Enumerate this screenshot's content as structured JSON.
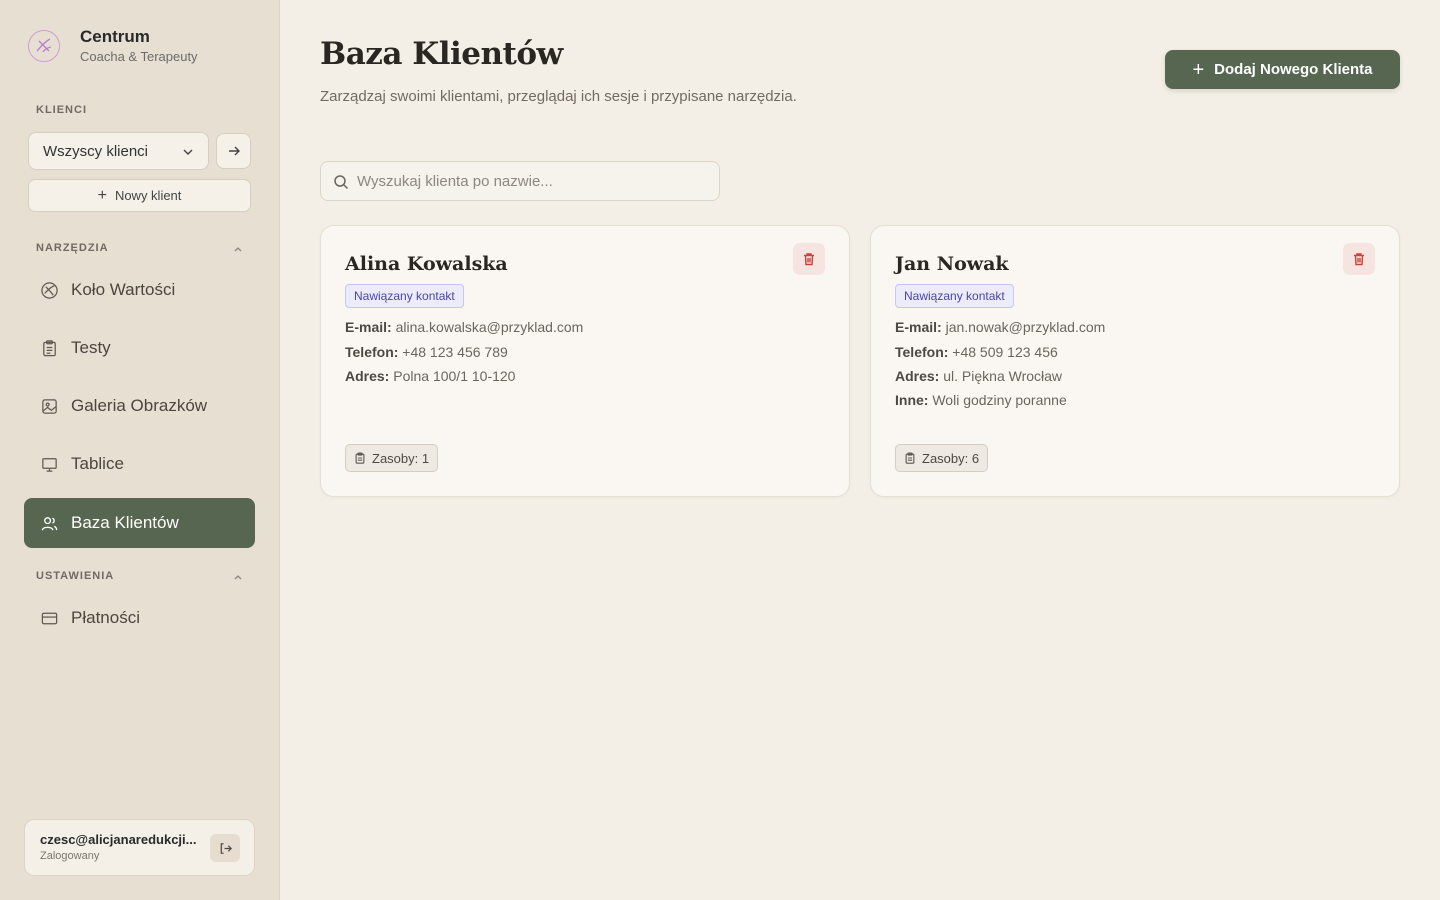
{
  "brand": {
    "title": "Centrum",
    "subtitle": "Coacha & Terapeuty"
  },
  "sidebar": {
    "clients_label": "KLIENCI",
    "client_select_value": "Wszyscy klienci",
    "new_client_label": "Nowy klient",
    "tools_label": "NARZĘDZIA",
    "tools": [
      {
        "label": "Koło Wartości",
        "icon": "wheel-icon"
      },
      {
        "label": "Testy",
        "icon": "clipboard-icon"
      },
      {
        "label": "Galeria Obrazków",
        "icon": "image-icon"
      },
      {
        "label": "Tablice",
        "icon": "board-icon"
      },
      {
        "label": "Baza Klientów",
        "icon": "users-icon",
        "active": true
      }
    ],
    "settings_label": "USTAWIENIA",
    "settings": [
      {
        "label": "Płatności",
        "icon": "credit-card-icon"
      }
    ]
  },
  "user": {
    "email": "czesc@alicjanaredukcji...",
    "status": "Zalogowany"
  },
  "main": {
    "title": "Baza Klientów",
    "subtitle": "Zarządzaj swoimi klientami, przeglądaj ich sesje i przypisane narzędzia.",
    "add_button_label": "Dodaj Nowego Klienta",
    "search_placeholder": "Wyszukaj klienta po nazwie..."
  },
  "clients": [
    {
      "name": "Alina Kowalska",
      "status": "Nawiązany kontakt",
      "email_label": "E-mail:",
      "email": "alina.kowalska@przyklad.com",
      "phone_label": "Telefon:",
      "phone": "+48 123 456 789",
      "address_label": "Adres:",
      "address": "Polna 100/1 10-120",
      "resources": "Zasoby: 1"
    },
    {
      "name": "Jan Nowak",
      "status": "Nawiązany kontakt",
      "email_label": "E-mail:",
      "email": "jan.nowak@przyklad.com",
      "phone_label": "Telefon:",
      "phone": "+48 509 123 456",
      "address_label": "Adres:",
      "address": "ul. Piękna Wrocław",
      "other_label": "Inne:",
      "other": "Woli godziny poranne",
      "resources": "Zasoby: 6"
    }
  ],
  "colors": {
    "accent": "#566650",
    "background": "#f4efe6",
    "sidebar": "#e8dfd3",
    "danger": "#c9413a"
  }
}
